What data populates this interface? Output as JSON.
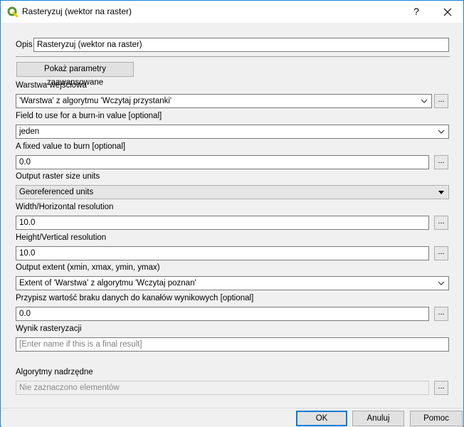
{
  "window": {
    "title": "Rasteryzuj (wektor na raster)",
    "help_label": "?",
    "close_label": "✕"
  },
  "form": {
    "opis_label": "Opis",
    "opis_value": "Rasteryzuj (wektor na raster)",
    "advanced_button": "Pokaż parametry zaawansowane",
    "input_layer_label": "Warstwa wejściowa",
    "input_layer_value": "'Warstwa' z algorytmu 'Wczytaj przystanki'",
    "burn_field_label": "Field to use for a burn-in value [optional]",
    "burn_field_value": "jeden",
    "fixed_value_label": "A fixed value to burn [optional]",
    "fixed_value_value": "0.0",
    "size_units_label": "Output raster size units",
    "size_units_value": "Georeferenced units",
    "width_label": "Width/Horizontal resolution",
    "width_value": "10.0",
    "height_label": "Height/Vertical resolution",
    "height_value": "10.0",
    "extent_label": "Output extent (xmin, xmax, ymin, ymax)",
    "extent_value": "Extent of 'Warstwa' z algorytmu 'Wczytaj poznan'",
    "nodata_label": "Przypisz wartość braku danych do kanałów wynikowych [optional]",
    "nodata_value": "0.0",
    "output_label": "Wynik rasteryzacji",
    "output_placeholder": "[Enter name if this is a final result]",
    "parent_label": "Algorytmy nadrzędne",
    "parent_value": "Nie zaznaczono elementów",
    "dots_label": "..."
  },
  "footer": {
    "ok": "OK",
    "cancel": "Anuluj",
    "help": "Pomoc"
  },
  "colors": {
    "accent": "#0078d7",
    "qgis_green": "#589632",
    "qgis_yellow": "#eec90d"
  }
}
